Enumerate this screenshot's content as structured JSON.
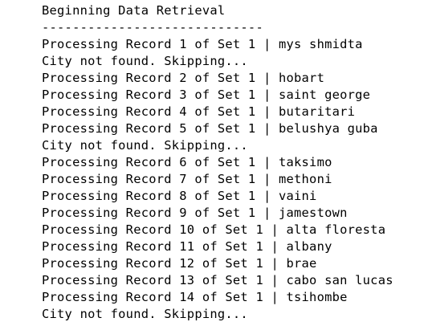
{
  "output": {
    "lines": [
      "Beginning Data Retrieval",
      "-----------------------------",
      "Processing Record 1 of Set 1 | mys shmidta",
      "City not found. Skipping...",
      "Processing Record 2 of Set 1 | hobart",
      "Processing Record 3 of Set 1 | saint george",
      "Processing Record 4 of Set 1 | butaritari",
      "Processing Record 5 of Set 1 | belushya guba",
      "City not found. Skipping...",
      "Processing Record 6 of Set 1 | taksimo",
      "Processing Record 7 of Set 1 | methoni",
      "Processing Record 8 of Set 1 | vaini",
      "Processing Record 9 of Set 1 | jamestown",
      "Processing Record 10 of Set 1 | alta floresta",
      "Processing Record 11 of Set 1 | albany",
      "Processing Record 12 of Set 1 | brae",
      "Processing Record 13 of Set 1 | cabo san lucas",
      "Processing Record 14 of Set 1 | tsihombe",
      "City not found. Skipping..."
    ]
  }
}
